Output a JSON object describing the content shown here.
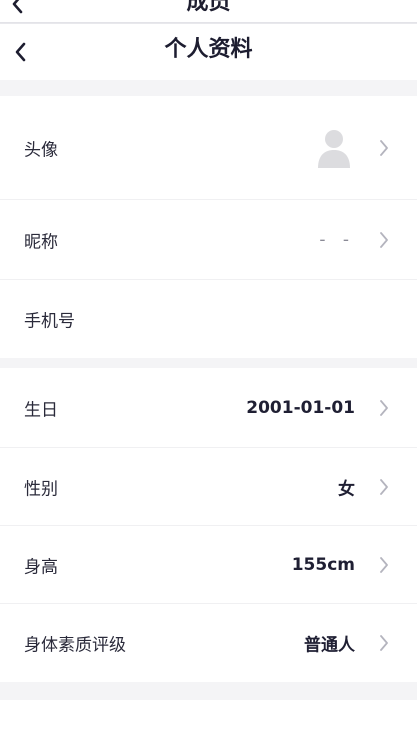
{
  "previous_screen": {
    "title": "成员"
  },
  "header": {
    "title": "个人资料"
  },
  "profile": {
    "basic": [
      {
        "key": "avatar",
        "label": "头像",
        "value": ""
      },
      {
        "key": "nickname",
        "label": "昵称",
        "value": "- -"
      },
      {
        "key": "phone",
        "label": "手机号",
        "value": ""
      }
    ],
    "body": [
      {
        "key": "birthday",
        "label": "生日",
        "value": "2001-01-01"
      },
      {
        "key": "gender",
        "label": "性别",
        "value": "女"
      },
      {
        "key": "height",
        "label": "身高",
        "value": "155cm"
      },
      {
        "key": "fitness-rating",
        "label": "身体素质评级",
        "value": "普通人"
      }
    ]
  },
  "icons": {
    "back": "chevron-left-icon",
    "disclosure": "chevron-right-icon",
    "avatar": "user-placeholder-icon"
  },
  "colors": {
    "background": "#f4f4f6",
    "surface": "#ffffff",
    "text_primary": "#1f1f33",
    "text_secondary": "#2a2a3a",
    "chevron": "#b4b4be",
    "avatar": "#dcdcdf"
  }
}
